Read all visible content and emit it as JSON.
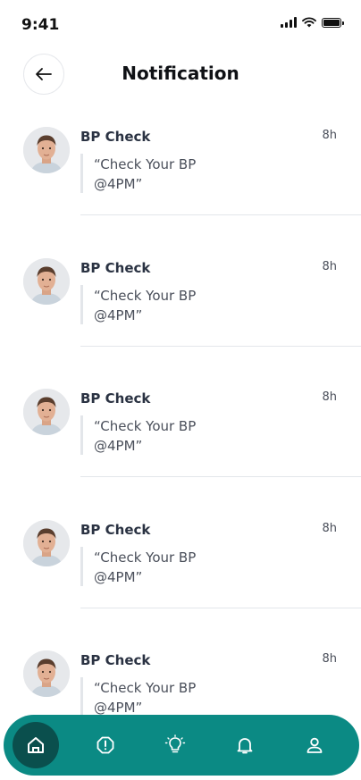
{
  "status_bar": {
    "time": "9:41"
  },
  "header": {
    "title": "Notification",
    "back_icon": "arrow-left-icon"
  },
  "notifications": [
    {
      "title": "BP Check",
      "time": "8h",
      "message": "“Check Your BP @4PM”"
    },
    {
      "title": "BP Check",
      "time": "8h",
      "message": "“Check Your BP @4PM”"
    },
    {
      "title": "BP Check",
      "time": "8h",
      "message": "“Check Your BP @4PM”"
    },
    {
      "title": "BP Check",
      "time": "8h",
      "message": "“Check Your BP @4PM”"
    },
    {
      "title": "BP Check",
      "time": "8h",
      "message": "“Check Your BP @4PM”"
    }
  ],
  "bottom_nav": {
    "items": [
      {
        "icon": "home-icon",
        "active": true
      },
      {
        "icon": "alert-icon",
        "active": false
      },
      {
        "icon": "lightbulb-icon",
        "active": false
      },
      {
        "icon": "bell-icon",
        "active": false
      },
      {
        "icon": "user-icon",
        "active": false
      }
    ]
  },
  "colors": {
    "nav_bg": "#0b8a84",
    "nav_active": "#0a4f4d"
  }
}
